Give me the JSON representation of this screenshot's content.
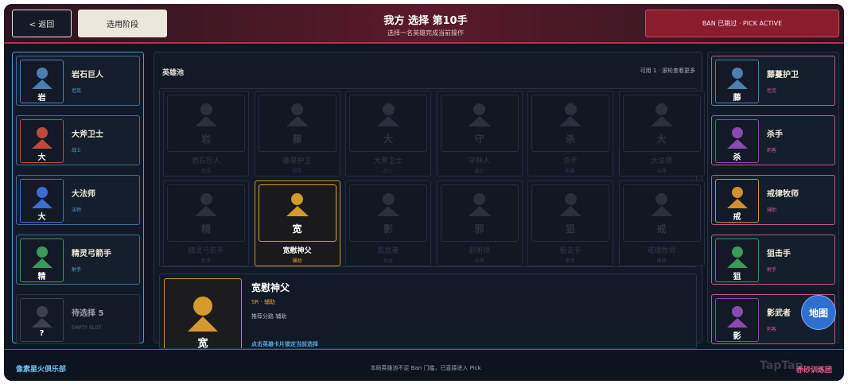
{
  "header": {
    "back_label": "< 返回",
    "stage_label": "选用阶段",
    "title": "我方 选择 第10手",
    "subtitle": "选择一名英雄完成当前操作",
    "status": "BAN 已跳过 · PICK ACTIVE"
  },
  "left_team": [
    {
      "name": "岩石巨人",
      "role": "坦克",
      "letter": "岩",
      "color": "#4a7fb0"
    },
    {
      "name": "大斧卫士",
      "role": "战士",
      "letter": "大",
      "color": "#c04a3a"
    },
    {
      "name": "大法师",
      "role": "法师",
      "letter": "大",
      "color": "#3a6fd0"
    },
    {
      "name": "精灵弓箭手",
      "role": "射手",
      "letter": "精",
      "color": "#3a9a5a"
    },
    {
      "name": "待选择 5",
      "role": "EMPTY SLOT",
      "letter": "?",
      "color": "#3a4250"
    }
  ],
  "right_team": [
    {
      "name": "藤蔓护卫",
      "role": "坦克",
      "letter": "藤",
      "color": "#4a7fb0"
    },
    {
      "name": "杀手",
      "role": "刺客",
      "letter": "杀",
      "color": "#8a4ab0"
    },
    {
      "name": "戒律牧师",
      "role": "辅助",
      "letter": "戒",
      "color": "#d09030"
    },
    {
      "name": "狙击手",
      "role": "射手",
      "letter": "狙",
      "color": "#3a9a5a"
    },
    {
      "name": "影武者",
      "role": "刺客",
      "letter": "影",
      "color": "#8a4ab0"
    }
  ],
  "pool": {
    "title": "英雄池",
    "hint": "可用 1 · 滚轮查看更多",
    "heroes": [
      {
        "name": "岩石巨人",
        "role": "坦克",
        "letter": "岩",
        "active": false
      },
      {
        "name": "藤蔓护卫",
        "role": "坦克",
        "letter": "藤",
        "active": false
      },
      {
        "name": "大斧卫士",
        "role": "战士",
        "letter": "大",
        "active": false
      },
      {
        "name": "守林人",
        "role": "战士",
        "letter": "守",
        "active": false
      },
      {
        "name": "杀手",
        "role": "刺客",
        "letter": "杀",
        "active": false
      },
      {
        "name": "大法师",
        "role": "法师",
        "letter": "大",
        "active": false
      },
      {
        "name": "精灵弓箭手",
        "role": "射手",
        "letter": "精",
        "active": false
      },
      {
        "name": "宽慰神父",
        "role": "辅助",
        "letter": "宽",
        "active": true
      },
      {
        "name": "影武者",
        "role": "刺客",
        "letter": "影",
        "active": false
      },
      {
        "name": "邪術师",
        "role": "法师",
        "letter": "邪",
        "active": false
      },
      {
        "name": "狙击手",
        "role": "射手",
        "letter": "狙",
        "active": false
      },
      {
        "name": "戒律牧师",
        "role": "辅助",
        "letter": "戒",
        "active": false
      }
    ]
  },
  "detail": {
    "name": "宽慰神父",
    "rarity": "SR · 辅助",
    "lane": "推荐分路  辅助",
    "action": "点击英雄卡片锁定当前选择",
    "letter": "宽"
  },
  "footer": {
    "club": "像素星火俱乐部",
    "note": "本局英雄池不足 Ban 门槛，已直接进入 Pick",
    "logo": "TapTap",
    "camp": "赤砂训练团"
  },
  "map_button": "地图",
  "colors": {
    "accent": "#c9902a",
    "ally": "#4aa0d0",
    "enemy": "#c05a86",
    "status": "#8a1c2e"
  }
}
